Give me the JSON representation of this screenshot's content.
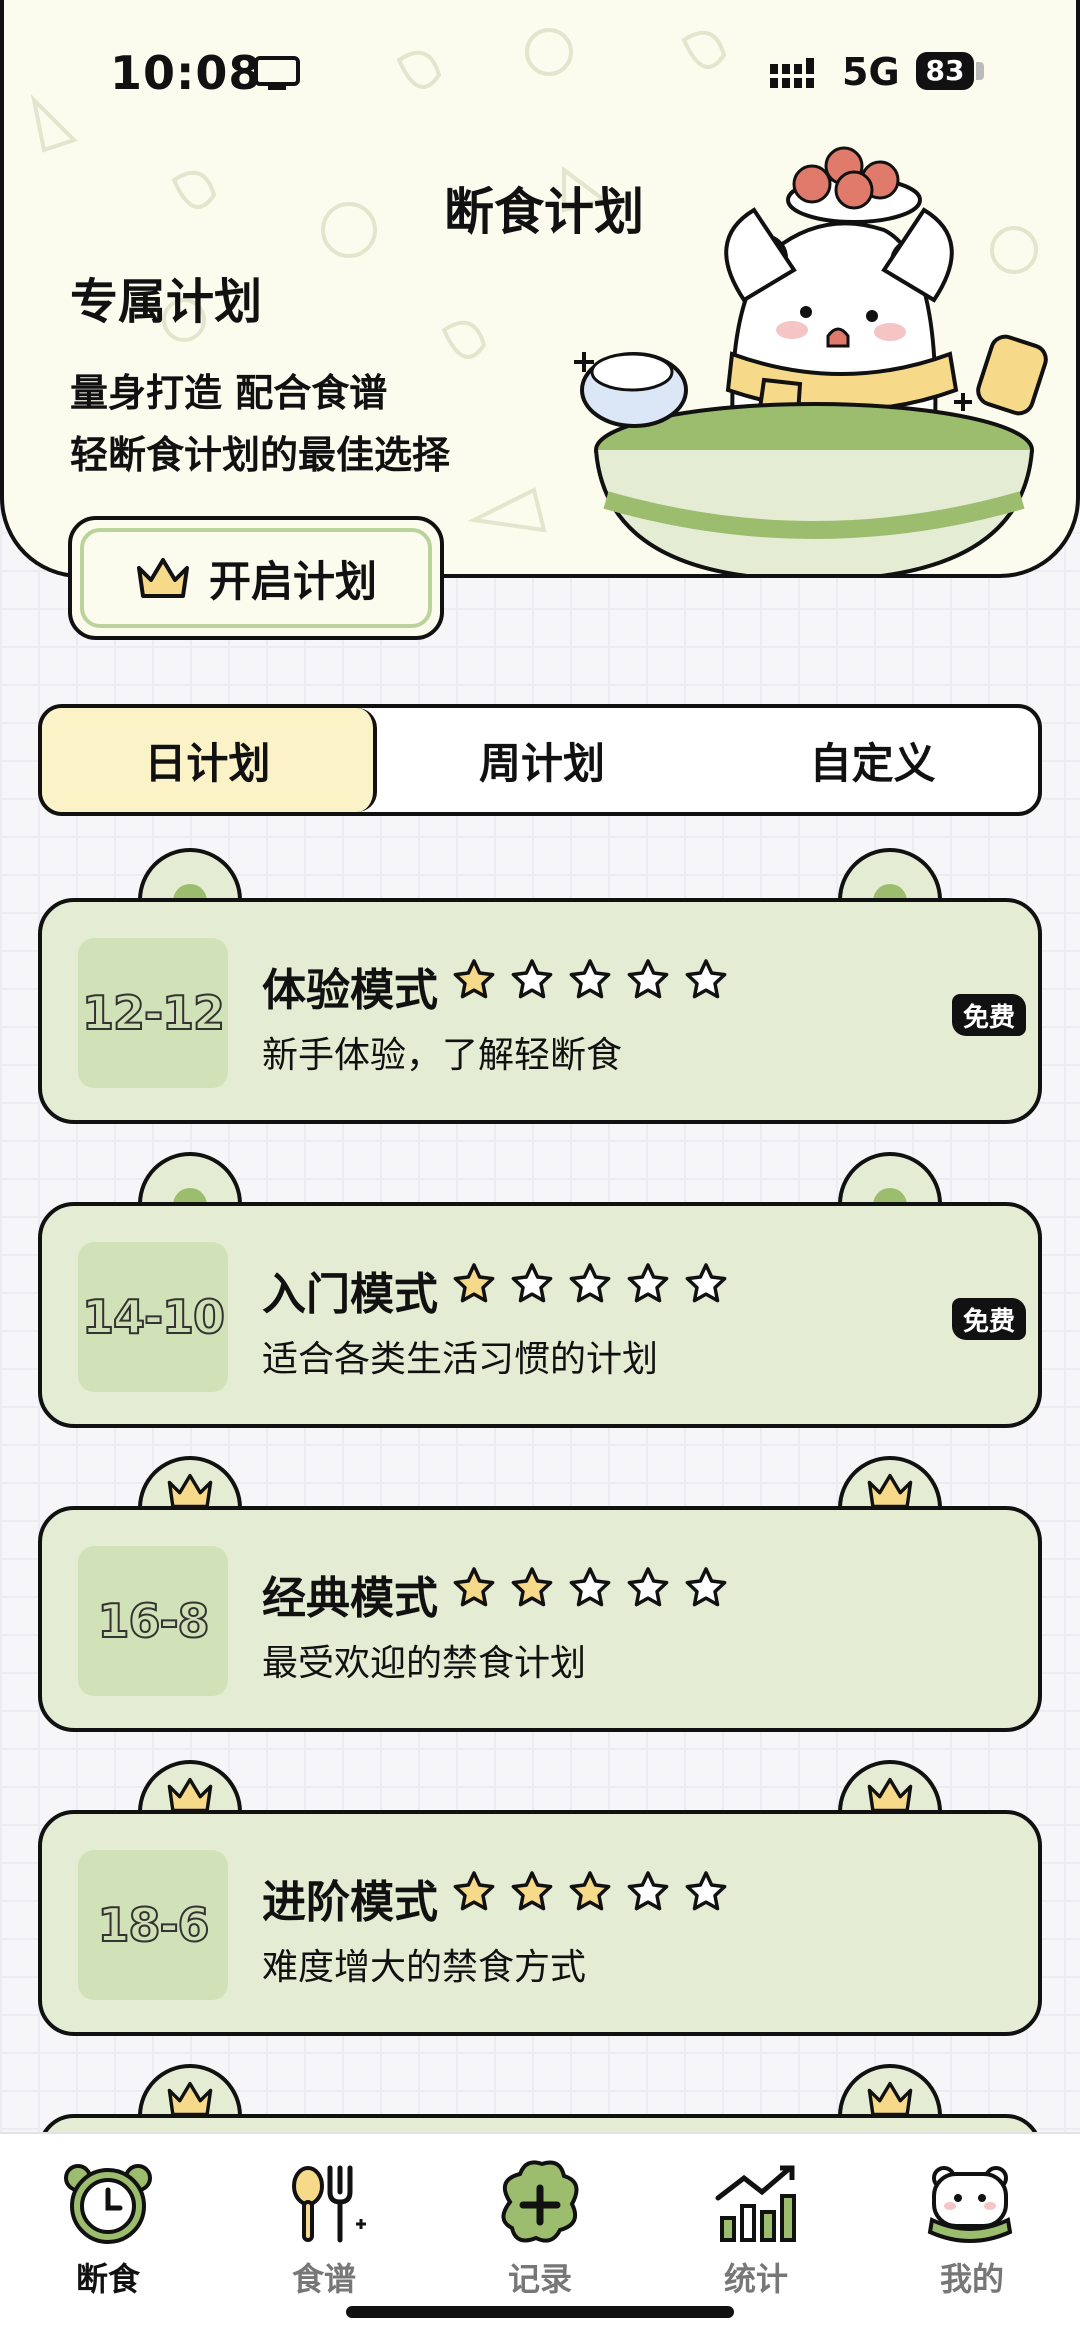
{
  "status_bar": {
    "time": "10:08",
    "network": "5G",
    "battery": "83"
  },
  "hero": {
    "title": "断食计划",
    "subtitle": "专属计划",
    "line1": "量身打造 配合食谱",
    "line2": "轻断食计划的最佳选择",
    "start_button": "开启计划"
  },
  "tabs": [
    {
      "label": "日计划",
      "active": true
    },
    {
      "label": "周计划",
      "active": false
    },
    {
      "label": "自定义",
      "active": false
    }
  ],
  "plans": [
    {
      "code": "12-12",
      "name": "体验模式",
      "stars": 1,
      "desc": "新手体验，了解轻断食",
      "badge": "免费",
      "tier": "free"
    },
    {
      "code": "14-10",
      "name": "入门模式",
      "stars": 1,
      "desc": "适合各类生活习惯的计划",
      "badge": "免费",
      "tier": "free"
    },
    {
      "code": "16-8",
      "name": "经典模式",
      "stars": 2,
      "desc": "最受欢迎的禁食计划",
      "badge": "",
      "tier": "vip"
    },
    {
      "code": "18-6",
      "name": "进阶模式",
      "stars": 3,
      "desc": "难度增大的禁食方式",
      "badge": "",
      "tier": "vip"
    }
  ],
  "bottom_nav": [
    {
      "label": "断食",
      "icon": "clock-icon",
      "active": true
    },
    {
      "label": "食谱",
      "icon": "utensils-icon",
      "active": false
    },
    {
      "label": "记录",
      "icon": "add-record-icon",
      "active": false
    },
    {
      "label": "统计",
      "icon": "stats-icon",
      "active": false
    },
    {
      "label": "我的",
      "icon": "profile-bear-icon",
      "active": false
    }
  ],
  "colors": {
    "accent_green": "#9cbc6e",
    "card_bg": "#e4ecd4",
    "active_tab": "#fbf2c7",
    "star_fill": "#f7d98a"
  }
}
